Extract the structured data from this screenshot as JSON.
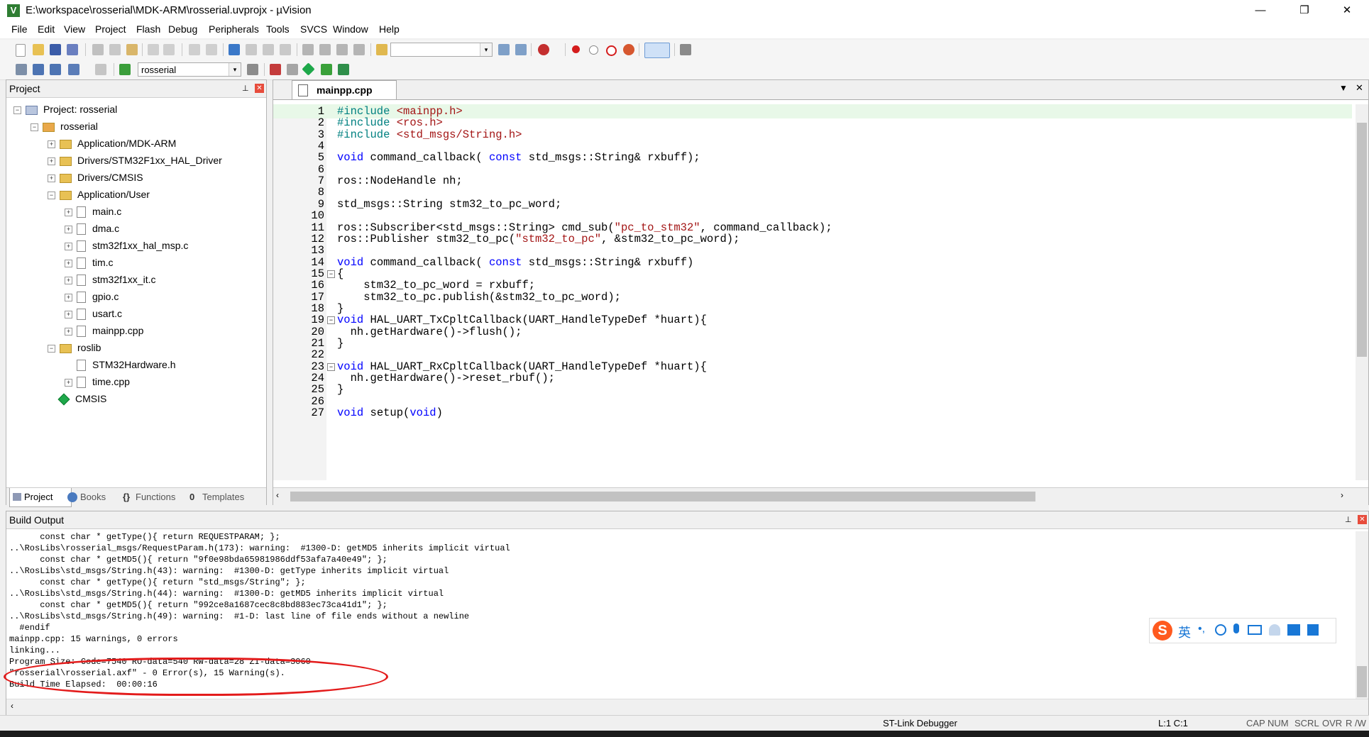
{
  "window": {
    "title": "E:\\workspace\\rosserial\\MDK-ARM\\rosserial.uvprojx - µVision",
    "icon": "V",
    "minimize": "—",
    "maximize": "❐",
    "close": "✕"
  },
  "menu": [
    "File",
    "Edit",
    "View",
    "Project",
    "Flash",
    "Debug",
    "Peripherals",
    "Tools",
    "SVCS",
    "Window",
    "Help"
  ],
  "toolbar": {
    "target_select": "rosserial",
    "dropdown_arrow": "▾"
  },
  "project_panel": {
    "title": "Project",
    "pin": "📌",
    "close": "✕",
    "tree": [
      {
        "label": "Project: rosserial",
        "icon": "project-icon",
        "expander": "−"
      },
      {
        "label": "rosserial",
        "icon": "target-icon",
        "expander": "−"
      },
      {
        "label": "Application/MDK-ARM",
        "icon": "folder-icon",
        "expander": "+"
      },
      {
        "label": "Drivers/STM32F1xx_HAL_Driver",
        "icon": "folder-icon",
        "expander": "+"
      },
      {
        "label": "Drivers/CMSIS",
        "icon": "folder-icon",
        "expander": "+"
      },
      {
        "label": "Application/User",
        "icon": "folder-icon",
        "expander": "−"
      },
      {
        "label": "main.c",
        "icon": "file-icon",
        "expander": "+"
      },
      {
        "label": "dma.c",
        "icon": "file-icon",
        "expander": "+"
      },
      {
        "label": "stm32f1xx_hal_msp.c",
        "icon": "file-icon",
        "expander": "+"
      },
      {
        "label": "tim.c",
        "icon": "file-icon",
        "expander": "+"
      },
      {
        "label": "stm32f1xx_it.c",
        "icon": "file-icon",
        "expander": "+"
      },
      {
        "label": "gpio.c",
        "icon": "file-icon",
        "expander": "+"
      },
      {
        "label": "usart.c",
        "icon": "file-icon",
        "expander": "+"
      },
      {
        "label": "mainpp.cpp",
        "icon": "file-icon",
        "expander": "+"
      },
      {
        "label": "roslib",
        "icon": "folder-icon",
        "expander": "−"
      },
      {
        "label": "STM32Hardware.h",
        "icon": "file-icon",
        "expander": ""
      },
      {
        "label": "time.cpp",
        "icon": "file-icon",
        "expander": "+"
      },
      {
        "label": "CMSIS",
        "icon": "cmsis-diamond-icon",
        "expander": ""
      }
    ],
    "tabs": [
      "Project",
      "Books",
      "Functions",
      "Templates"
    ]
  },
  "editor": {
    "tab": "mainpp.cpp",
    "lines": [
      {
        "n": "1",
        "code": "#include <mainpp.h>"
      },
      {
        "n": "2",
        "code": "#include <ros.h>"
      },
      {
        "n": "3",
        "code": "#include <std_msgs/String.h>"
      },
      {
        "n": "4",
        "code": ""
      },
      {
        "n": "5",
        "code": "void command_callback( const std_msgs::String& rxbuff);"
      },
      {
        "n": "6",
        "code": ""
      },
      {
        "n": "7",
        "code": "ros::NodeHandle nh;"
      },
      {
        "n": "8",
        "code": ""
      },
      {
        "n": "9",
        "code": "std_msgs::String stm32_to_pc_word;"
      },
      {
        "n": "10",
        "code": ""
      },
      {
        "n": "11",
        "code": "ros::Subscriber<std_msgs::String> cmd_sub(\"pc_to_stm32\", command_callback);"
      },
      {
        "n": "12",
        "code": "ros::Publisher stm32_to_pc(\"stm32_to_pc\", &stm32_to_pc_word);"
      },
      {
        "n": "13",
        "code": ""
      },
      {
        "n": "14",
        "code": "void command_callback( const std_msgs::String& rxbuff)"
      },
      {
        "n": "15",
        "code": "{"
      },
      {
        "n": "16",
        "code": "    stm32_to_pc_word = rxbuff;"
      },
      {
        "n": "17",
        "code": "    stm32_to_pc.publish(&stm32_to_pc_word);"
      },
      {
        "n": "18",
        "code": "}"
      },
      {
        "n": "19",
        "code": "void HAL_UART_TxCpltCallback(UART_HandleTypeDef *huart){"
      },
      {
        "n": "20",
        "code": "  nh.getHardware()->flush();"
      },
      {
        "n": "21",
        "code": "}"
      },
      {
        "n": "22",
        "code": ""
      },
      {
        "n": "23",
        "code": "void HAL_UART_RxCpltCallback(UART_HandleTypeDef *huart){"
      },
      {
        "n": "24",
        "code": "  nh.getHardware()->reset_rbuf();"
      },
      {
        "n": "25",
        "code": "}"
      },
      {
        "n": "26",
        "code": ""
      },
      {
        "n": "27",
        "code": "void setup(void)"
      }
    ]
  },
  "build_output": {
    "title": "Build Output",
    "lines": [
      "      const char * getType(){ return REQUESTPARAM; };",
      "..\\RosLibs\\rosserial_msgs/RequestParam.h(173): warning:  #1300-D: getMD5 inherits implicit virtual",
      "      const char * getMD5(){ return \"9f0e98bda65981986ddf53afa7a40e49\"; };",
      "..\\RosLibs\\std_msgs/String.h(43): warning:  #1300-D: getType inherits implicit virtual",
      "      const char * getType(){ return \"std_msgs/String\"; };",
      "..\\RosLibs\\std_msgs/String.h(44): warning:  #1300-D: getMD5 inherits implicit virtual",
      "      const char * getMD5(){ return \"992ce8a1687cec8c8bd883ec73ca41d1\"; };",
      "..\\RosLibs\\std_msgs/String.h(49): warning:  #1-D: last line of file ends without a newline",
      "  #endif",
      "mainpp.cpp: 15 warnings, 0 errors",
      "linking...",
      "Program Size: Code=7540 RO-data=540 RW-data=28 ZI-data=3060",
      "\"rosserial\\rosserial.axf\" - 0 Error(s), 15 Warning(s).",
      "Build Time Elapsed:  00:00:16"
    ]
  },
  "ime_bar": {
    "logo": "S",
    "lang": "英"
  },
  "statusbar": {
    "debugger": "ST-Link Debugger",
    "position": "L:1 C:1",
    "cap": "CAP",
    "num": "NUM",
    "scrl": "SCRL",
    "ovr": "OVR",
    "rw": "R /W"
  },
  "colors": {
    "keyword": "#0000ff",
    "preprocessor": "#008080",
    "string": "#a31515",
    "highlight_line": "#e8f8e8",
    "annotation_red": "#e31b1b"
  }
}
